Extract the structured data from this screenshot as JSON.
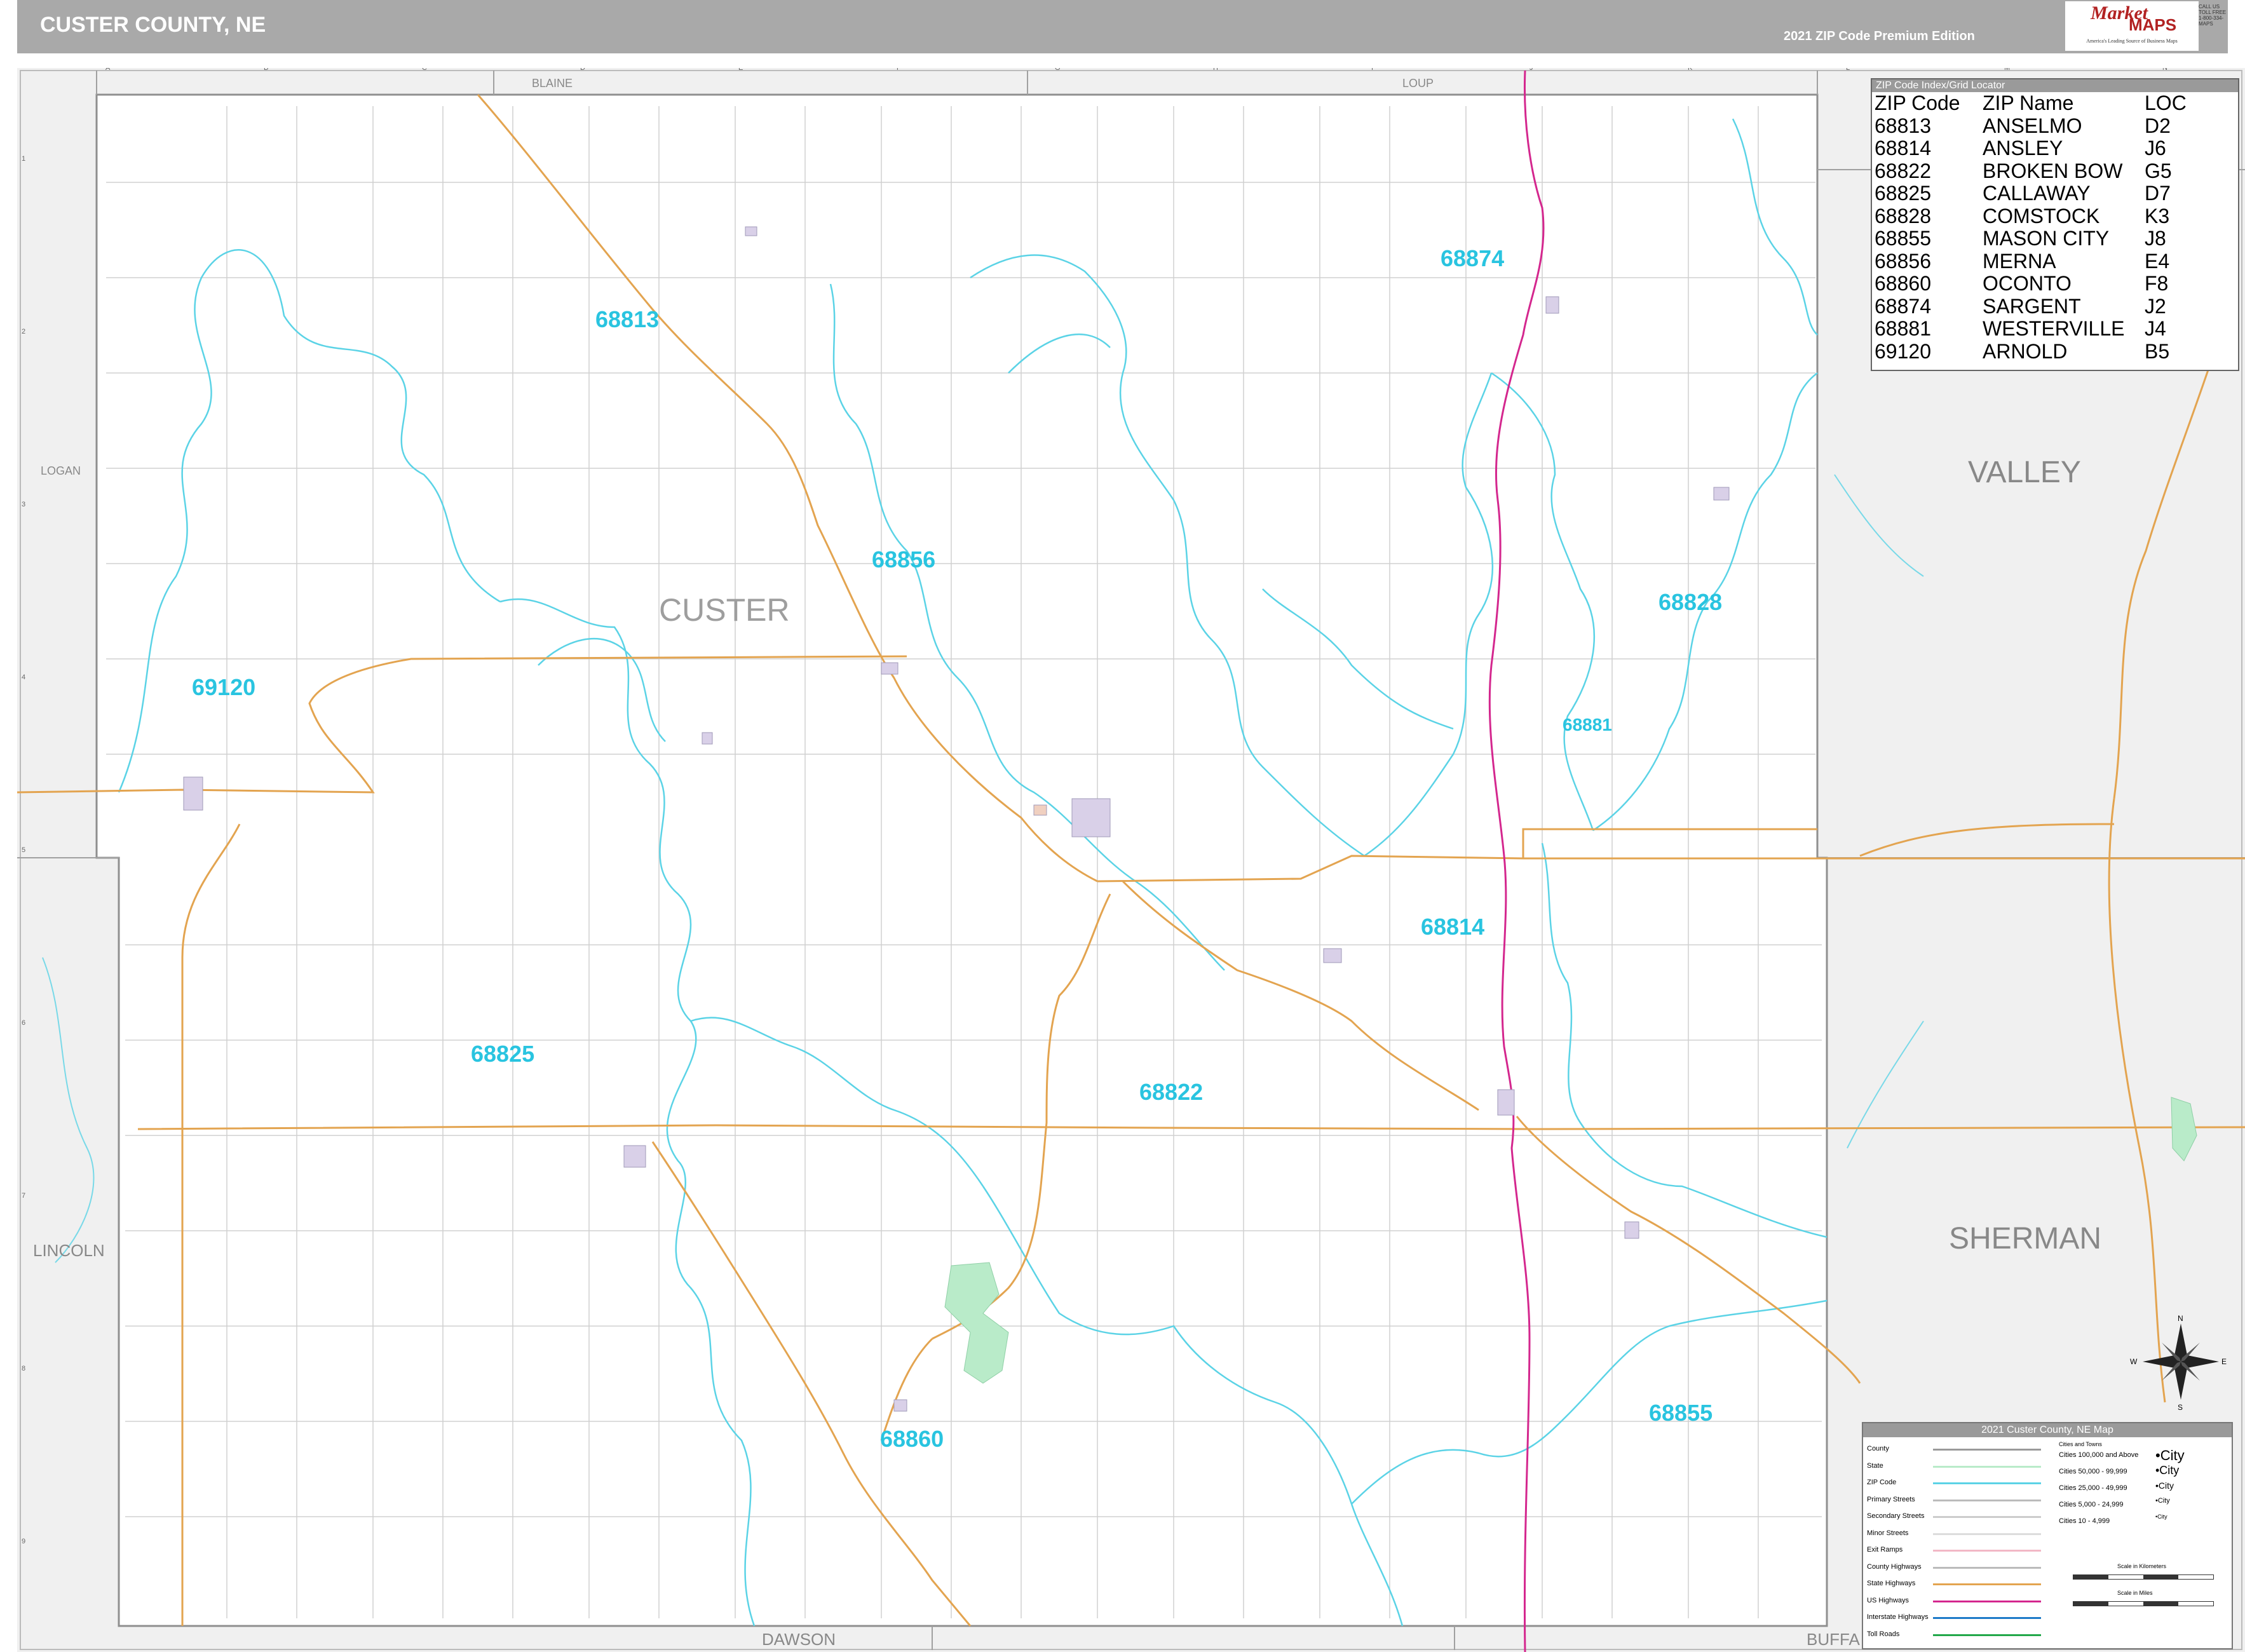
{
  "header": {
    "title": "CUSTER COUNTY, NE",
    "edition": "2021 ZIP Code Premium Edition",
    "logo_brand": "Market",
    "logo_maps": "MAPS",
    "logo_tagline": "America's Leading Source of Business Maps",
    "logo_phone": "CALL US TOLL FREE 1-800-334-MAPS"
  },
  "map": {
    "county_label": "CUSTER",
    "neighbor_counties": [
      {
        "id": "blaine",
        "label": "BLAINE"
      },
      {
        "id": "loup",
        "label": "LOUP"
      },
      {
        "id": "logan",
        "label": "LOGAN"
      },
      {
        "id": "valley",
        "label": "VALLEY"
      },
      {
        "id": "lincoln",
        "label": "LINCOLN"
      },
      {
        "id": "sherman",
        "label": "SHERMAN"
      },
      {
        "id": "dawson",
        "label": "DAWSON"
      },
      {
        "id": "buffalo",
        "label": "BUFFA"
      }
    ],
    "zip_labels": [
      "68874",
      "68813",
      "68856",
      "69120",
      "68828",
      "68881",
      "68814",
      "68825",
      "68822",
      "68855",
      "68860"
    ],
    "grid_columns": [
      "A",
      "B",
      "C",
      "D",
      "E",
      "F",
      "G",
      "H",
      "I",
      "J",
      "K",
      "L",
      "M",
      "N"
    ],
    "grid_rows": [
      "1",
      "2",
      "3",
      "4",
      "5",
      "6",
      "7",
      "8",
      "9"
    ],
    "colors": {
      "zip_boundary": "#5bd3e6",
      "zip_label": "#29c4e0",
      "state_highway": "#e3a450",
      "us_highway": "#d4278e",
      "county_boundary": "#8f8f8f",
      "outside_fill": "#f0f0f0",
      "minor_street": "#c8c8c8"
    }
  },
  "locator": {
    "title": "ZIP Code Index/Grid Locator",
    "columns": [
      "ZIP Code",
      "ZIP Name",
      "LOC"
    ],
    "rows": [
      [
        "68813",
        "ANSELMO",
        "D2"
      ],
      [
        "68814",
        "ANSLEY",
        "J6"
      ],
      [
        "68822",
        "BROKEN BOW",
        "G5"
      ],
      [
        "68825",
        "CALLAWAY",
        "D7"
      ],
      [
        "68828",
        "COMSTOCK",
        "K3"
      ],
      [
        "68855",
        "MASON CITY",
        "J8"
      ],
      [
        "68856",
        "MERNA",
        "E4"
      ],
      [
        "68860",
        "OCONTO",
        "F8"
      ],
      [
        "68874",
        "SARGENT",
        "J2"
      ],
      [
        "68881",
        "WESTERVILLE",
        "J4"
      ],
      [
        "69120",
        "ARNOLD",
        "B5"
      ]
    ]
  },
  "compass": {
    "n": "N",
    "s": "S",
    "e": "E",
    "w": "W"
  },
  "legend": {
    "title": "2021 Custer County, NE Map",
    "items": [
      {
        "label": "County",
        "color": "#9a9a9a"
      },
      {
        "label": "State",
        "color": "#b9ebc9"
      },
      {
        "label": "ZIP Code",
        "color": "#5bd3e6"
      },
      {
        "label": "Primary Streets",
        "color": "#bbbbbb"
      },
      {
        "label": "Secondary Streets",
        "color": "#cccccc"
      },
      {
        "label": "Minor Streets",
        "color": "#dddddd"
      },
      {
        "label": "Exit Ramps",
        "color": "#f2b8c6"
      },
      {
        "label": "County Highways",
        "color": "#bbbbbb"
      },
      {
        "label": "State Highways",
        "color": "#e3a450"
      },
      {
        "label": "US Highways",
        "color": "#d4278e"
      },
      {
        "label": "Interstate Highways",
        "color": "#1e7ac8"
      },
      {
        "label": "Toll Roads",
        "color": "#22a84a"
      }
    ],
    "cities_title": "Cities and Towns",
    "cities": [
      {
        "label": "Cities 100,000 and Above",
        "sample": "•City"
      },
      {
        "label": "Cities 50,000 - 99,999",
        "sample": "•City"
      },
      {
        "label": "Cities 25,000 - 49,999",
        "sample": "•City"
      },
      {
        "label": "Cities 5,000 - 24,999",
        "sample": "•City"
      },
      {
        "label": "Cities 10 - 4,999",
        "sample": "•City"
      }
    ],
    "scale_km": "Scale in Kilometers",
    "scale_mi": "Scale in Miles"
  }
}
